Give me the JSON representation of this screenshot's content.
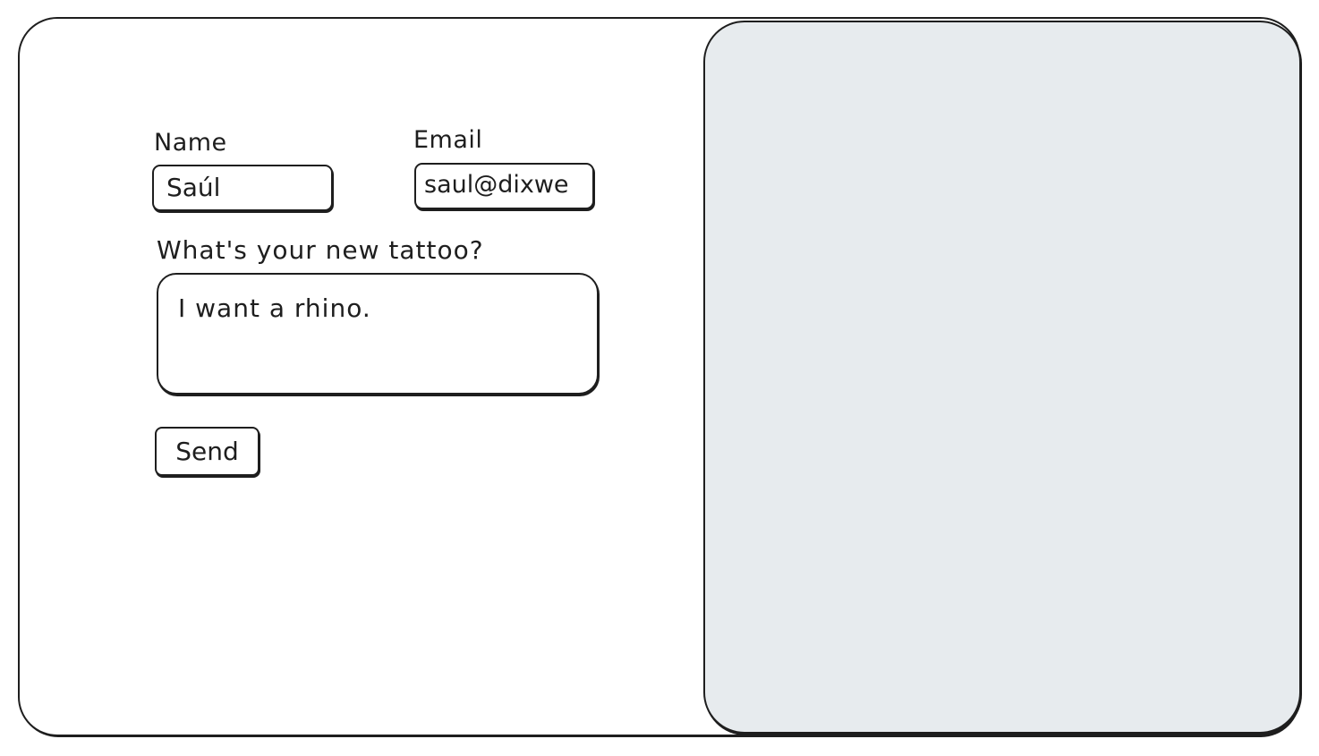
{
  "form": {
    "name_label": "Name",
    "name_value": "Saúl",
    "email_label": "Email",
    "email_value": "saul@dixwe",
    "tattoo_label": "What's your new tattoo?",
    "tattoo_value": "I want a rhino.",
    "send_label": "Send"
  },
  "colors": {
    "stroke": "#1e1e1e",
    "background": "#ffffff",
    "preview_panel": "#e7ebee"
  }
}
